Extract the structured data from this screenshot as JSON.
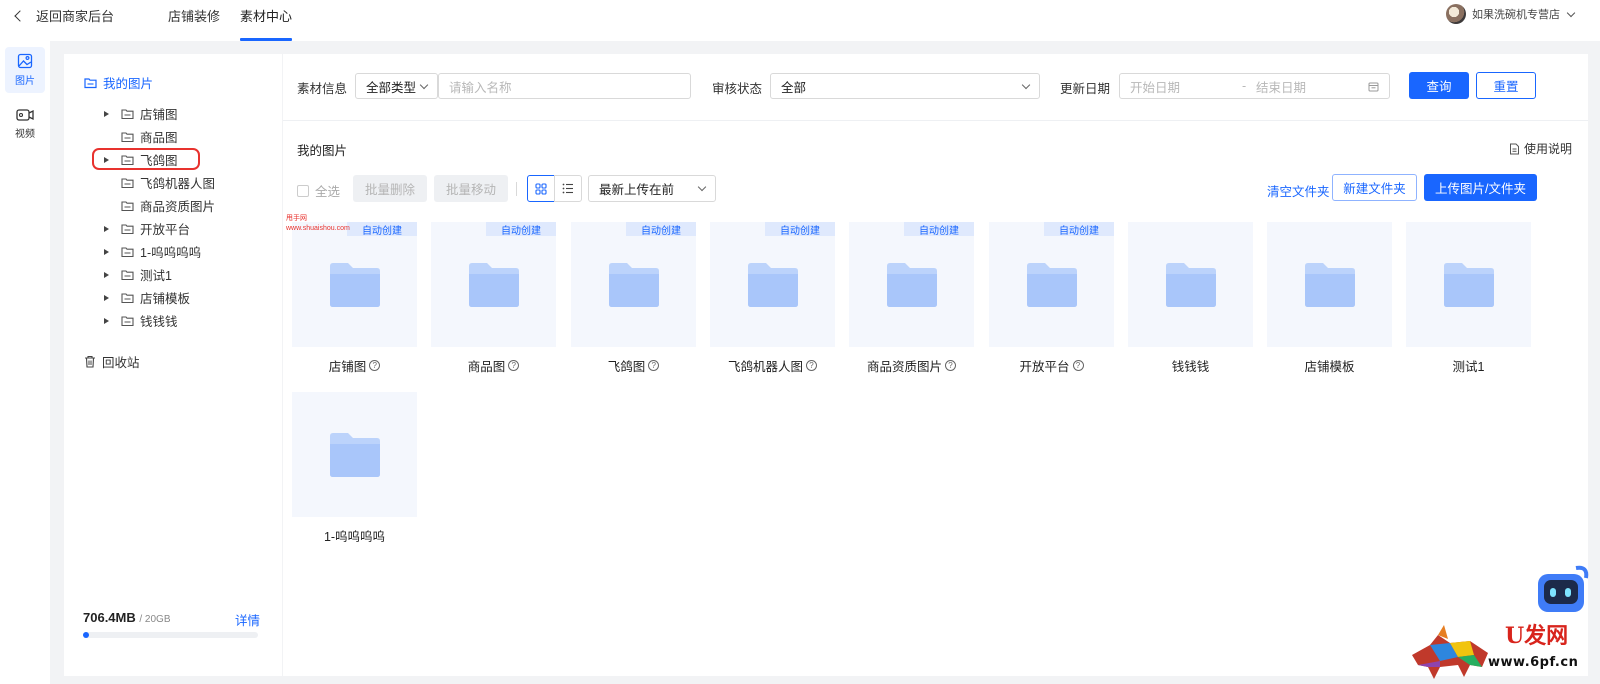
{
  "header": {
    "back_label": "返回商家后台",
    "tabs": [
      {
        "label": "店铺装修",
        "active": false
      },
      {
        "label": "素材中心",
        "active": true
      }
    ],
    "shop_name": "如果洗碗机专营店"
  },
  "rail": {
    "items": [
      {
        "label": "图片",
        "icon": "image-icon",
        "active": true
      },
      {
        "label": "视频",
        "icon": "video-icon",
        "active": false
      }
    ]
  },
  "tree": {
    "root_label": "我的图片",
    "nodes": [
      {
        "label": "店铺图",
        "expandable": true
      },
      {
        "label": "商品图",
        "expandable": false
      },
      {
        "label": "飞鸽图",
        "expandable": true
      },
      {
        "label": "飞鸽机器人图",
        "expandable": false
      },
      {
        "label": "商品资质图片",
        "expandable": false
      },
      {
        "label": "开放平台",
        "expandable": true
      },
      {
        "label": "1-呜呜呜呜",
        "expandable": true
      },
      {
        "label": "测试1",
        "expandable": true
      },
      {
        "label": "店铺模板",
        "expandable": true
      },
      {
        "label": "钱钱钱",
        "expandable": true
      }
    ],
    "trash_label": "回收站",
    "storage": {
      "used": "706.4MB",
      "total": "/ 20GB",
      "detail_label": "详情",
      "used_fraction": 0.034
    }
  },
  "filter": {
    "material_label": "素材信息",
    "type_value": "全部类型",
    "name_placeholder": "请输入名称",
    "review_label": "审核状态",
    "review_value": "全部",
    "date_label": "更新日期",
    "start_placeholder": "开始日期",
    "date_sep": "-",
    "end_placeholder": "结束日期",
    "query_label": "查询",
    "reset_label": "重置"
  },
  "content": {
    "section_title": "我的图片",
    "help_label": "使用说明",
    "select_all_label": "全选",
    "batch_delete_label": "批量删除",
    "batch_move_label": "批量移动",
    "sort_value": "最新上传在前",
    "clear_label": "清空文件夹",
    "new_folder_label": "新建文件夹",
    "upload_label": "上传图片/文件夹",
    "auto_tag": "自动创建",
    "folders": [
      {
        "name": "店铺图",
        "auto": true,
        "help": true
      },
      {
        "name": "商品图",
        "auto": true,
        "help": true
      },
      {
        "name": "飞鸽图",
        "auto": true,
        "help": true
      },
      {
        "name": "飞鸽机器人图",
        "auto": true,
        "help": true
      },
      {
        "name": "商品资质图片",
        "auto": true,
        "help": true
      },
      {
        "name": "开放平台",
        "auto": true,
        "help": true
      },
      {
        "name": "钱钱钱",
        "auto": false,
        "help": false
      },
      {
        "name": "店铺模板",
        "auto": false,
        "help": false
      },
      {
        "name": "测试1",
        "auto": false,
        "help": false
      },
      {
        "name": "1-呜呜呜呜",
        "auto": false,
        "help": false
      }
    ]
  },
  "watermark": {
    "small_line1": "甩手网",
    "small_line2": "www.shuaishou.com",
    "brand_cn": "U发网",
    "brand_url": "www.6pf.cn"
  },
  "colors": {
    "accent": "#1966ff",
    "highlight": "#e8322e",
    "folder": "#bcd3fb"
  }
}
